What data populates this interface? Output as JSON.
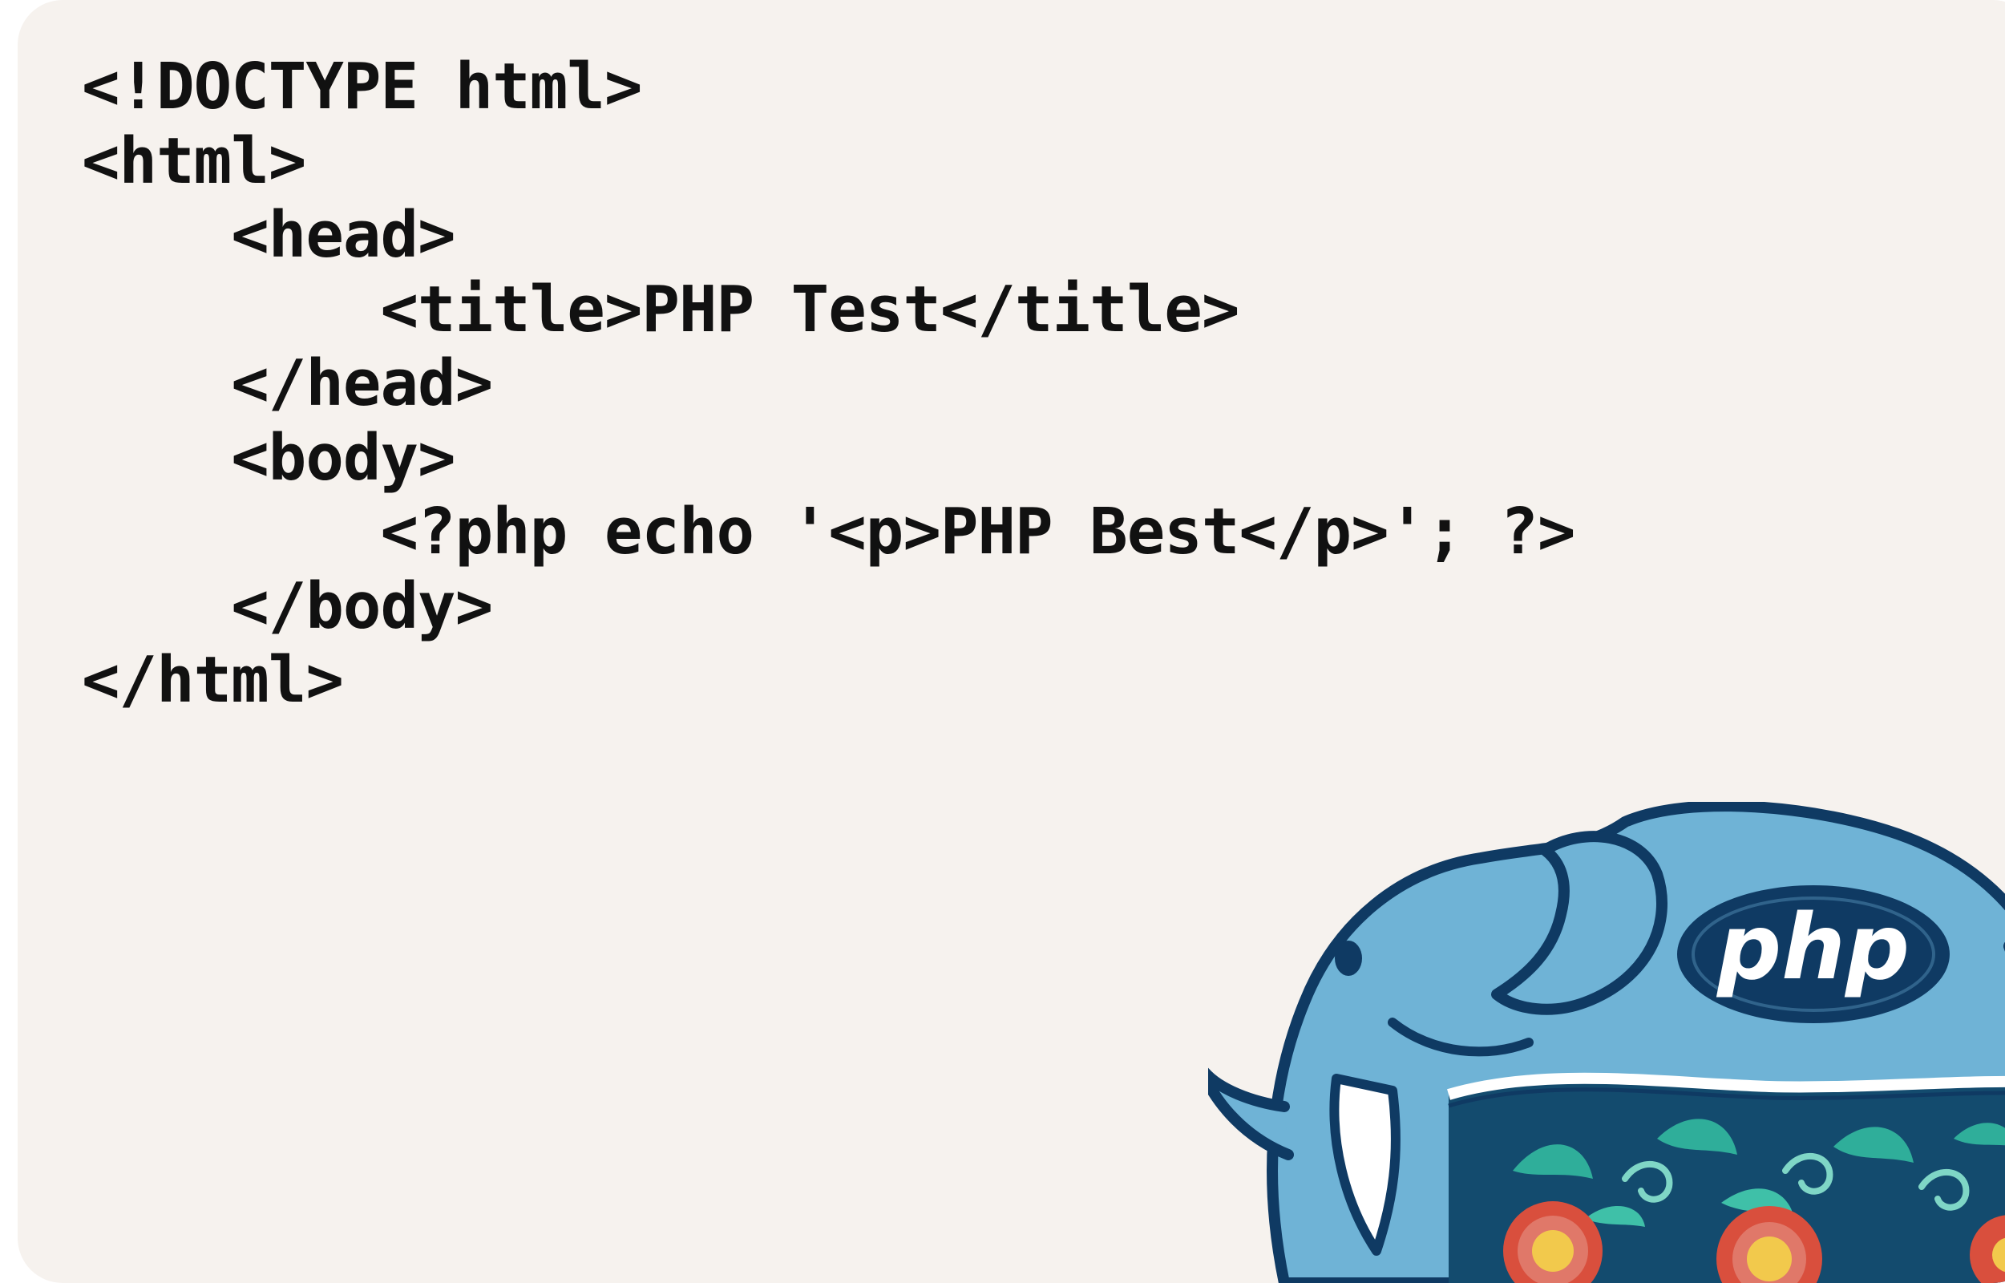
{
  "code": {
    "lines": [
      "<!DOCTYPE html>",
      "<html>",
      "    <head>",
      "        <title>PHP Test</title>",
      "    </head>",
      "    <body>",
      "        <?php echo '<p>PHP Best</p>'; ?>",
      "    </body>",
      "</html>"
    ]
  },
  "mascot": {
    "icon": "php-elephant-icon",
    "logo_text": "php",
    "colors": {
      "body": "#6fb3d6",
      "outline": "#0f3a63",
      "logo_oval": "#0f3a63",
      "logo_text": "#ffffff",
      "blanket": "#134b6e",
      "flower_red": "#d94f3d",
      "flower_yellow": "#f2c94c",
      "leaf_teal": "#2fae9a",
      "background": "#f6f2ee"
    }
  }
}
